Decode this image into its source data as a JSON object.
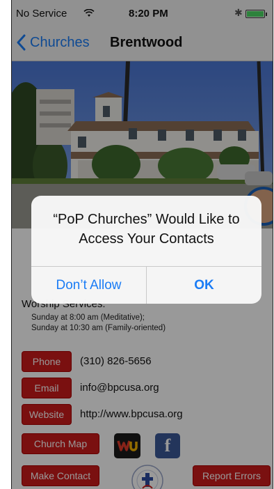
{
  "status_bar": {
    "carrier": "No Service",
    "time": "8:20 PM",
    "bluetooth": "✱"
  },
  "nav": {
    "back_label": "Churches",
    "title": "Brentwood"
  },
  "worship": {
    "title": "Worship Services:",
    "lines": [
      "Sunday at 8:00 am (Meditative);",
      "Sunday at 10:30 am (Family-oriented)"
    ]
  },
  "contact": {
    "phone_label": "Phone",
    "phone_value": "(310) 826-5656",
    "email_label": "Email",
    "email_value": "info@bpcusa.org",
    "website_label": "Website",
    "website_value": "http://www.bpcusa.org",
    "map_label": "Church Map",
    "make_contact_label": "Make Contact",
    "report_label": "Report Errors"
  },
  "icons": {
    "wu": "weather-underground-icon",
    "facebook_glyph": "f"
  },
  "alert": {
    "title": "“PoP Churches” Would Like to Access Your Contacts",
    "deny_label": "Don’t Allow",
    "ok_label": "OK"
  },
  "colors": {
    "accent": "#1a7cf5",
    "button_red": "#cc1b1b",
    "facebook": "#3b5998"
  }
}
